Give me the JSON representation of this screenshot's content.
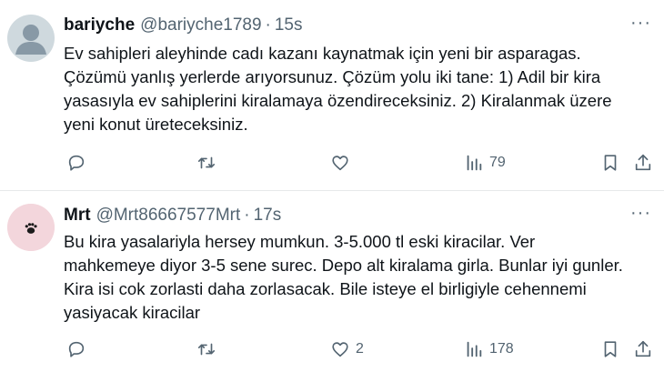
{
  "tweets": [
    {
      "name": "bariyche",
      "handle": "@bariyche1789",
      "separator": "·",
      "time": "15s",
      "more": "···",
      "lines": [
        "Ev sahipleri aleyhinde cadı kazanı kaynatmak için yeni bir asparagas.",
        "Çözümü yanlış yerlerde arıyorsunuz. Çözüm yolu iki tane: 1) Adil bir kira",
        "yasasıyla ev sahiplerini kiralamaya özendireceksiniz. 2) Kiralanmak üzere",
        "yeni konut üreteceksiniz."
      ],
      "likes": "",
      "views": "79",
      "avatar_icon": "default-user-icon",
      "avatar_bg": "#cfd9de"
    },
    {
      "name": "Mrt",
      "handle": "@Mrt86667577Mrt",
      "separator": "·",
      "time": "17s",
      "more": "···",
      "lines": [
        "Bu kira yasalariyla hersey mumkun. 3-5.000 tl eski kiracilar. Ver",
        "mahkemeye diyor 3-5 sene surec.  Depo alt kiralama girla. Bunlar iyi gunler.",
        "Kira isi cok zorlasti daha zorlasacak. Bile isteye el birligiyle cehennemi",
        "yasiyacak kiracilar"
      ],
      "likes": "2",
      "views": "178",
      "avatar_icon": "paw-icon",
      "avatar_bg": "#f3d6dc"
    }
  ],
  "colors": {
    "text": "#0f1419",
    "secondary": "#536471",
    "divider": "#e7e9ea"
  }
}
